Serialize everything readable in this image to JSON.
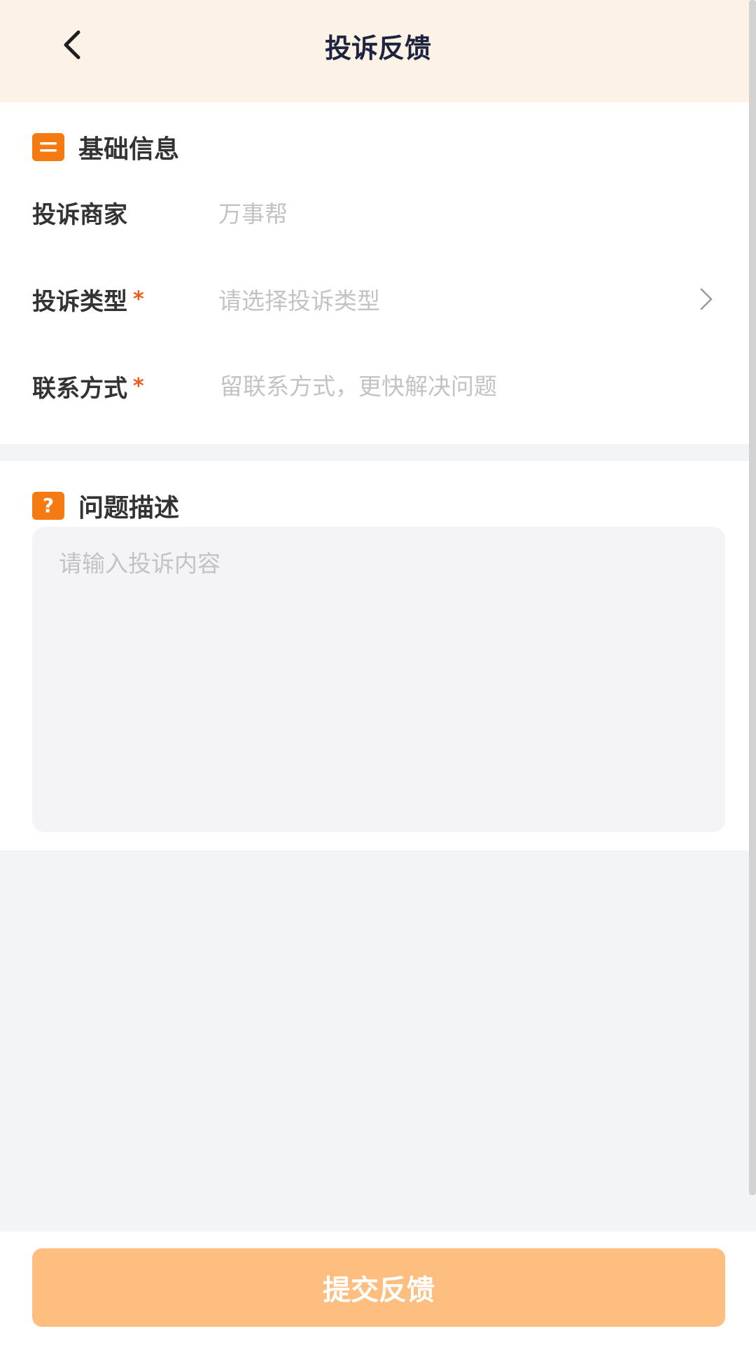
{
  "header": {
    "title": "投诉反馈",
    "back_icon": "chevron-left-icon"
  },
  "basic_info": {
    "title": "基础信息",
    "icon": "list-icon",
    "accent_color": "#f57a12",
    "rows": [
      {
        "label": "投诉商家",
        "value": "万事帮",
        "required": false
      },
      {
        "label": "投诉类型",
        "placeholder": "请选择投诉类型",
        "required": true,
        "icon": "chevron-right-icon"
      },
      {
        "label": "联系方式",
        "placeholder": "留联系方式，更快解决问题",
        "required": true
      }
    ],
    "required_mark": "*"
  },
  "description": {
    "title": "问题描述",
    "icon": "question-icon",
    "icon_glyph": "?",
    "placeholder": "请输入投诉内容"
  },
  "footer": {
    "submit_label": "提交反馈",
    "submit_color": "#fdbe80"
  }
}
